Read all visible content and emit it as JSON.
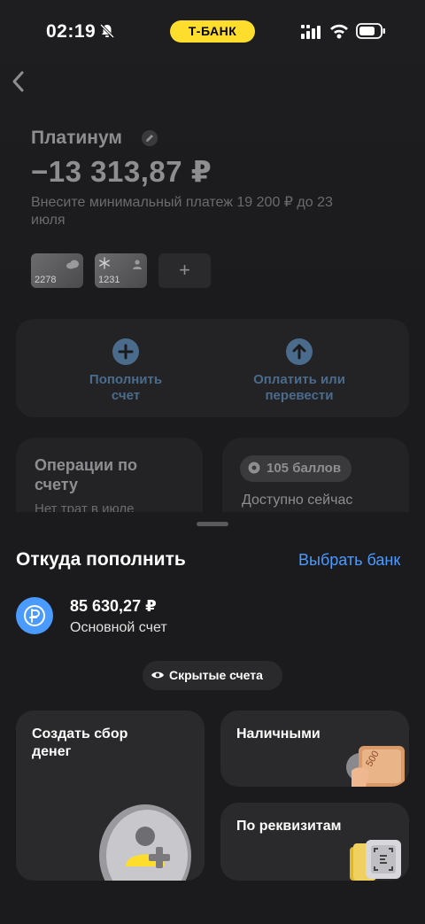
{
  "status_bar": {
    "time": "02:19",
    "brand": "Т-БАНК"
  },
  "account": {
    "name": "Платинум",
    "balance": "−13 313,87 ₽",
    "hint": "Внесите минимальный платеж 19 200 ₽ до 23 июля",
    "cards": [
      {
        "last4": "2278"
      },
      {
        "last4": "1231"
      }
    ],
    "add_card": "+"
  },
  "actions": {
    "top_up": "Пополнить счет",
    "pay": "Оплатить или перевести"
  },
  "tiles": {
    "operations_title": "Операции по счету",
    "operations_sub": "Нет трат в июле",
    "points": "105 баллов",
    "available_now": "Доступно сейчас"
  },
  "sheet": {
    "title": "Откуда пополнить",
    "choose_bank": "Выбрать банк",
    "source_amount": "85 630,27 ₽",
    "source_name": "Основной счет",
    "hidden_accounts": "Скрытые счета",
    "options": {
      "fundraise": "Создать сбор денег",
      "cash": "Наличными",
      "requisites": "По реквизитам"
    },
    "cash_note_value": "500"
  }
}
